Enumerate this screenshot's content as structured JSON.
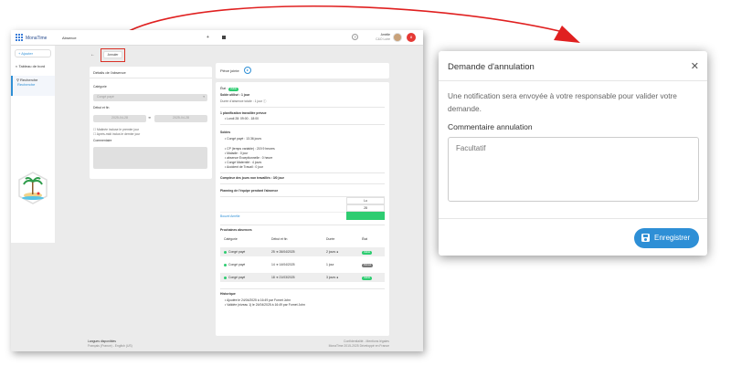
{
  "app": {
    "brand": "MonaTime",
    "module": "Absence",
    "user_name": "Amélie",
    "user_role": "C&O Loire",
    "help_icon": "help-icon",
    "add_icon": "plus-icon",
    "calendar_icon": "calendar-icon",
    "notification_count": "8"
  },
  "sidebar": {
    "add_label": "Ajouter",
    "dashboard_label": "Tableau de bord",
    "search_label": "Recherche",
    "search_sub": "Recherche"
  },
  "toolbar": {
    "back_icon": "arrow-left-icon",
    "cancel_label": "Annuler"
  },
  "details": {
    "title": "Détails de l'absence",
    "category_label": "Catégorie",
    "category_value": "Congé payé",
    "dates_label": "Début et fin",
    "start_date": "2025-04-28",
    "end_date": "2025-04-28",
    "check1": "Matinée incluse le premier jour",
    "check2": "Après-midi inclus le dernier jour",
    "comment_label": "Commentaire"
  },
  "attachment": {
    "label": "Pièce jointe"
  },
  "summary": {
    "state_label": "État :",
    "state_badge": "Validé",
    "used_balance": "Solde utilisé : 1 jour",
    "total_duration": "Durée d'absence totale : 1 jour",
    "planning_title": "1 planification travaillée prévue",
    "planning_item": "Lundi 28: 09:00 - 18:00",
    "balances_title": "Soldes",
    "balances": [
      "Congé payé : 13.36 jours",
      "CP (temps variable) : 219.9 heures",
      "Maladie : 0 jour",
      "absence Exceptionnelle : 0 heure",
      "Congé Maternité : 4 jours",
      "Accident de Travail : 0 jour"
    ],
    "counter": "Compteur des jours non travaillés : 3/0 jour",
    "team_title": "Planning de l'équipe pendant l'absence",
    "team_day": "Lu",
    "team_date": "28",
    "team_member": "Bouzel Amélie",
    "next_title": "Prochaines absences",
    "next_headers": [
      "Catégorie",
      "Début et fin",
      "Durée",
      "État"
    ],
    "next_rows": [
      {
        "cat": "Congé payé",
        "dates": "25 ➔ 26/04/2025",
        "dur": "2 jours",
        "state": "Validé"
      },
      {
        "cat": "Congé payé",
        "dates": "14 ➔ 14/04/2025",
        "dur": "1 jour",
        "state": "Refusé"
      },
      {
        "cat": "Congé payé",
        "dates": "18 ➔ 21/03/2025",
        "dur": "3 jours",
        "state": "Validé"
      }
    ],
    "history_title": "Historique",
    "history": [
      "Ajoutée le 24/04/2025 à 16:49 par Fornet John",
      "Validée (niveau 1) le 24/04/2025 à 16:49 par Fornet John"
    ]
  },
  "footer": {
    "lang_title": "Langues disponibles",
    "langs": "Français (France) - English (US)",
    "right1": "Confidentialité - Mentions légales",
    "right2": "MonaTime 2015-2025 Développé en France"
  },
  "modal": {
    "title": "Demande d'annulation",
    "close_icon": "close-icon",
    "message": "Une notification sera envoyée à votre responsable pour valider votre demande.",
    "comment_label": "Commentaire annulation",
    "comment_placeholder": "Facultatif",
    "save_label": "Enregistrer",
    "save_icon": "floppy-disk-icon"
  },
  "colors": {
    "accent": "#2e8fd6",
    "highlight_box": "#d93025",
    "arrow": "#e02020",
    "success": "#2ecc71"
  }
}
